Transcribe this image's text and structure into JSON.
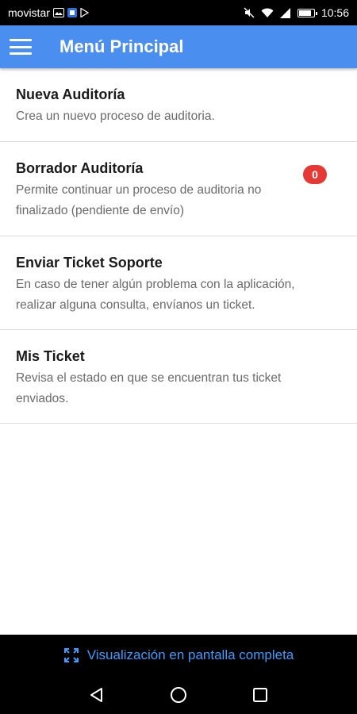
{
  "status_bar": {
    "carrier": "movistar",
    "time": "10:56"
  },
  "app_bar": {
    "title": "Menú Principal",
    "menu_icon": "hamburger-menu-icon"
  },
  "menu_items": [
    {
      "title": "Nueva Auditoría",
      "description": "Crea un nuevo proceso de auditoria."
    },
    {
      "title": "Borrador Auditoría",
      "description": "Permite continuar un proceso de auditoria no finalizado (pendiente de envío)",
      "badge": "0"
    },
    {
      "title": "Enviar Ticket Soporte",
      "description": "En caso de tener algún problema con la aplicación, realizar alguna consulta, envíanos un ticket."
    },
    {
      "title": "Mis Ticket",
      "description": "Revisa el estado en que se encuentran tus ticket enviados."
    }
  ],
  "fullscreen_bar": {
    "label": "Visualización en pantalla completa",
    "icon": "fullscreen-expand-icon"
  },
  "nav_bar": {
    "back_icon": "back-triangle-icon",
    "home_icon": "home-circle-icon",
    "recents_icon": "recents-square-icon"
  },
  "colors": {
    "app_bar": "#4a8ef0",
    "badge": "#e53935",
    "fullscreen_text": "#3f9bff"
  }
}
